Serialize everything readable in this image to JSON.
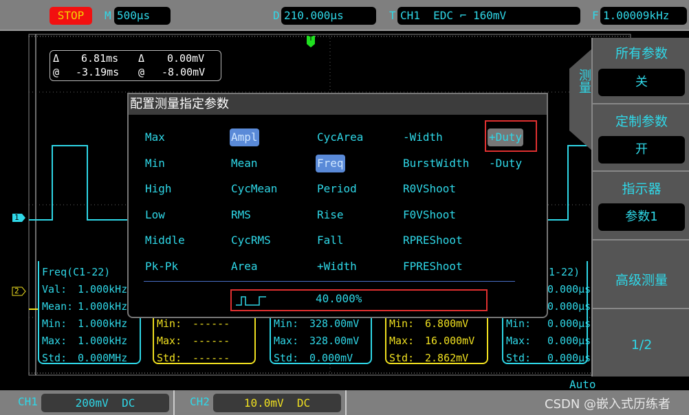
{
  "topbar": {
    "run_state": "STOP",
    "timebase_label": "M",
    "timebase": "500µs",
    "delay_label": "D",
    "delay": "210.000µs",
    "trigger_label": "T",
    "trigger": "CH1  EDC ⌐ 160mV",
    "freq_label": "F",
    "freq": "1.00009kHz"
  },
  "cursor": {
    "dx_sym": "Δ",
    "dx": "6.81ms",
    "dy_sym": "Δ",
    "dy": "0.00mV",
    "x_sym": "@",
    "x": "-3.19ms",
    "y_sym": "@",
    "y": "-8.00mV"
  },
  "markers": {
    "trigger": "T",
    "ch1": "1",
    "ch2": "2"
  },
  "menu": {
    "tab": "测量",
    "items": [
      {
        "label": "所有参数",
        "value": "关"
      },
      {
        "label": "定制参数",
        "value": "开"
      },
      {
        "label": "指示器",
        "value": "参数1"
      },
      {
        "label": "高级测量"
      },
      {
        "label": "1/2"
      }
    ]
  },
  "dialog": {
    "title": "配置测量指定参数",
    "options": [
      [
        "Max",
        "Min",
        "High",
        "Low",
        "Middle",
        "Pk-Pk"
      ],
      [
        "Ampl",
        "Mean",
        "CycMean",
        "RMS",
        "CycRMS",
        "Area"
      ],
      [
        "CycArea",
        "Freq",
        "Period",
        "Rise",
        "Fall",
        "+Width"
      ],
      [
        "-Width",
        "BurstWidth",
        "R0VShoot",
        "F0VShoot",
        "RPREShoot",
        "FPREShoot"
      ],
      [
        "+Duty",
        "-Duty"
      ]
    ],
    "selected": [
      "Ampl",
      "Freq"
    ],
    "highlighted": "+Duty",
    "result_icon": "pulse-icon",
    "result_value": "40.000%"
  },
  "measure_boxes": [
    {
      "title": "Freq(C1-22)",
      "rows": [
        [
          "Val:",
          "1.000kHz"
        ],
        [
          "Mean:",
          "1.000kHz"
        ],
        [
          "Min:",
          "1.000kHz"
        ],
        [
          "Max:",
          "1.000kHz"
        ],
        [
          "Std:",
          "0.000MHz"
        ]
      ],
      "color": "#2fd8e8"
    },
    {
      "title": "",
      "rows": [
        [
          "",
          ""
        ],
        [
          "",
          ""
        ],
        [
          "Min:",
          "------"
        ],
        [
          "Max:",
          "------"
        ],
        [
          "Std:",
          "------"
        ]
      ],
      "color": "#f0e020"
    },
    {
      "title": "",
      "rows": [
        [
          "",
          ""
        ],
        [
          "",
          ""
        ],
        [
          "Min:",
          "328.00mV"
        ],
        [
          "Max:",
          "328.00mV"
        ],
        [
          "Std:",
          "0.000mV"
        ]
      ],
      "color": "#2fd8e8"
    },
    {
      "title": "",
      "rows": [
        [
          "",
          ""
        ],
        [
          "",
          ""
        ],
        [
          "Min:",
          "6.800mV"
        ],
        [
          "Max:",
          "16.000mV"
        ],
        [
          "Std:",
          "2.862mV"
        ]
      ],
      "color": "#f0e020"
    },
    {
      "title": "1-22)",
      "rows": [
        [
          "",
          "0.000µs"
        ],
        [
          "",
          "0.000µs"
        ],
        [
          "Min:",
          "0.000µs"
        ],
        [
          "Max:",
          "0.000µs"
        ],
        [
          "Std:",
          "0.000µs"
        ]
      ],
      "color": "#2fd8e8"
    }
  ],
  "status": "Auto",
  "bottombar": {
    "ch1_label": "CH1",
    "ch1": "200mV  DC",
    "ch2_label": "CH2",
    "ch2": "10.0mV  DC"
  },
  "watermark": "CSDN @嵌入式历练者",
  "colors": {
    "ch1": "#2fd8e8",
    "ch2": "#f0e020",
    "stop": "#f21010",
    "selected": "#5a8ad8",
    "highlight_box": "#e03030"
  }
}
